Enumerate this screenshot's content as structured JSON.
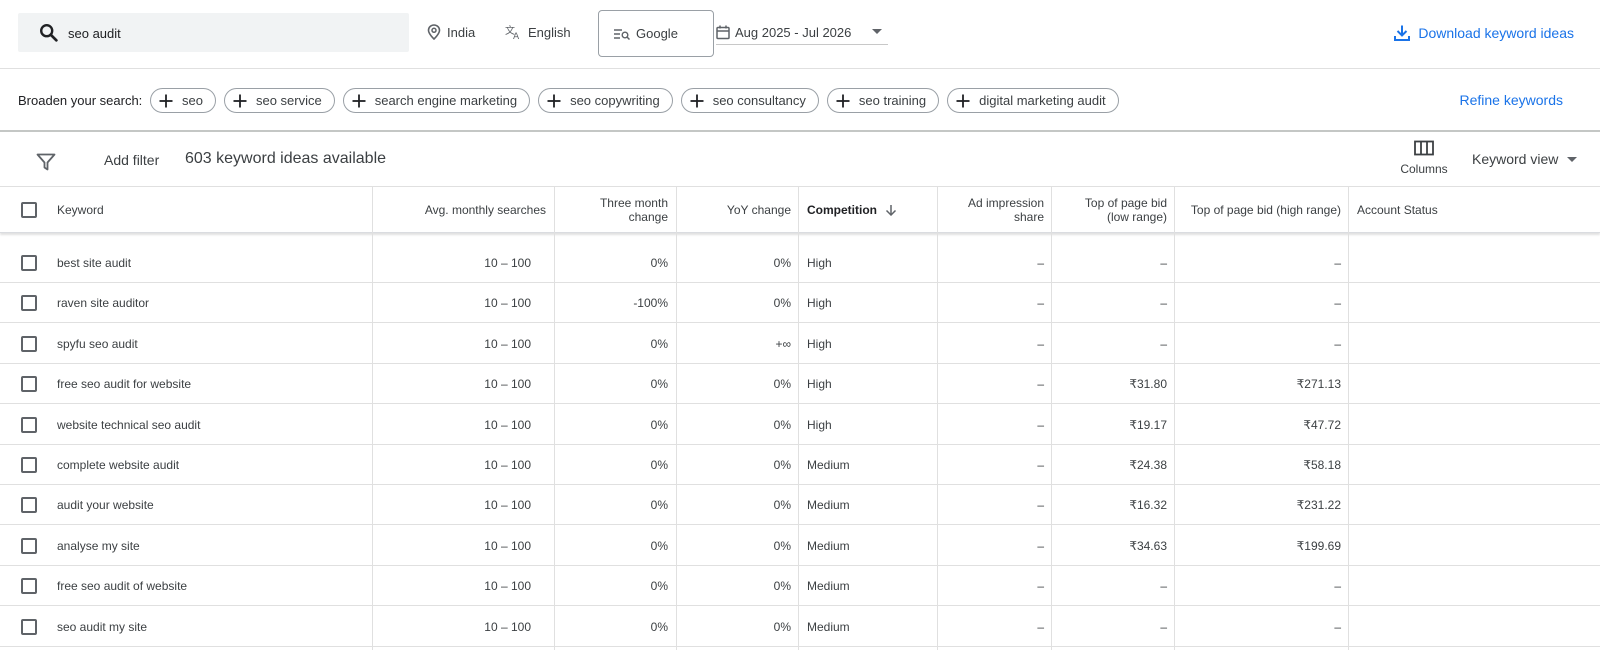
{
  "search": {
    "query": "seo audit"
  },
  "top": {
    "location": "India",
    "language": "English",
    "network": "Google",
    "date_range": "Aug 2025 - Jul 2026",
    "download_label": "Download keyword ideas"
  },
  "broaden": {
    "label": "Broaden your search:",
    "chips": [
      "seo",
      "seo service",
      "search engine marketing",
      "seo copywriting",
      "seo consultancy",
      "seo training",
      "digital marketing audit"
    ],
    "refine_label": "Refine keywords"
  },
  "filterbar": {
    "add_filter": "Add filter",
    "count_text": "603 keyword ideas available",
    "columns_label": "Columns",
    "view_label": "Keyword view"
  },
  "table": {
    "headers": {
      "keyword": "Keyword",
      "searches": "Avg. monthly searches",
      "three_month_1": "Three month",
      "three_month_2": "change",
      "yoy": "YoY change",
      "competition": "Competition",
      "ad_share_1": "Ad impression",
      "ad_share_2": "share",
      "bid_low_1": "Top of page bid",
      "bid_low_2": "(low range)",
      "bid_high": "Top of page bid (high range)",
      "account_status": "Account Status"
    },
    "rows": [
      {
        "keyword": "best site audit",
        "searches": "10 – 100",
        "three_month": "0%",
        "yoy": "0%",
        "competition": "High",
        "ad_share": "–",
        "bid_low": "–",
        "bid_high": "–"
      },
      {
        "keyword": "raven site auditor",
        "searches": "10 – 100",
        "three_month": "-100%",
        "yoy": "0%",
        "competition": "High",
        "ad_share": "–",
        "bid_low": "–",
        "bid_high": "–"
      },
      {
        "keyword": "spyfu seo audit",
        "searches": "10 – 100",
        "three_month": "0%",
        "yoy": "+∞",
        "competition": "High",
        "ad_share": "–",
        "bid_low": "–",
        "bid_high": "–"
      },
      {
        "keyword": "free seo audit for website",
        "searches": "10 – 100",
        "three_month": "0%",
        "yoy": "0%",
        "competition": "High",
        "ad_share": "–",
        "bid_low": "₹31.80",
        "bid_high": "₹271.13"
      },
      {
        "keyword": "website technical seo audit",
        "searches": "10 – 100",
        "three_month": "0%",
        "yoy": "0%",
        "competition": "High",
        "ad_share": "–",
        "bid_low": "₹19.17",
        "bid_high": "₹47.72"
      },
      {
        "keyword": "complete website audit",
        "searches": "10 – 100",
        "three_month": "0%",
        "yoy": "0%",
        "competition": "Medium",
        "ad_share": "–",
        "bid_low": "₹24.38",
        "bid_high": "₹58.18"
      },
      {
        "keyword": "audit your website",
        "searches": "10 – 100",
        "three_month": "0%",
        "yoy": "0%",
        "competition": "Medium",
        "ad_share": "–",
        "bid_low": "₹16.32",
        "bid_high": "₹231.22"
      },
      {
        "keyword": "analyse my site",
        "searches": "10 – 100",
        "three_month": "0%",
        "yoy": "0%",
        "competition": "Medium",
        "ad_share": "–",
        "bid_low": "₹34.63",
        "bid_high": "₹199.69"
      },
      {
        "keyword": "free seo audit of website",
        "searches": "10 – 100",
        "three_month": "0%",
        "yoy": "0%",
        "competition": "Medium",
        "ad_share": "–",
        "bid_low": "–",
        "bid_high": "–"
      },
      {
        "keyword": "seo audit my site",
        "searches": "10 – 100",
        "three_month": "0%",
        "yoy": "0%",
        "competition": "Medium",
        "ad_share": "–",
        "bid_low": "–",
        "bid_high": "–"
      }
    ]
  },
  "colors": {
    "accent": "#1a73e8",
    "text": "#3c4043",
    "border": "#e0e0e0"
  }
}
